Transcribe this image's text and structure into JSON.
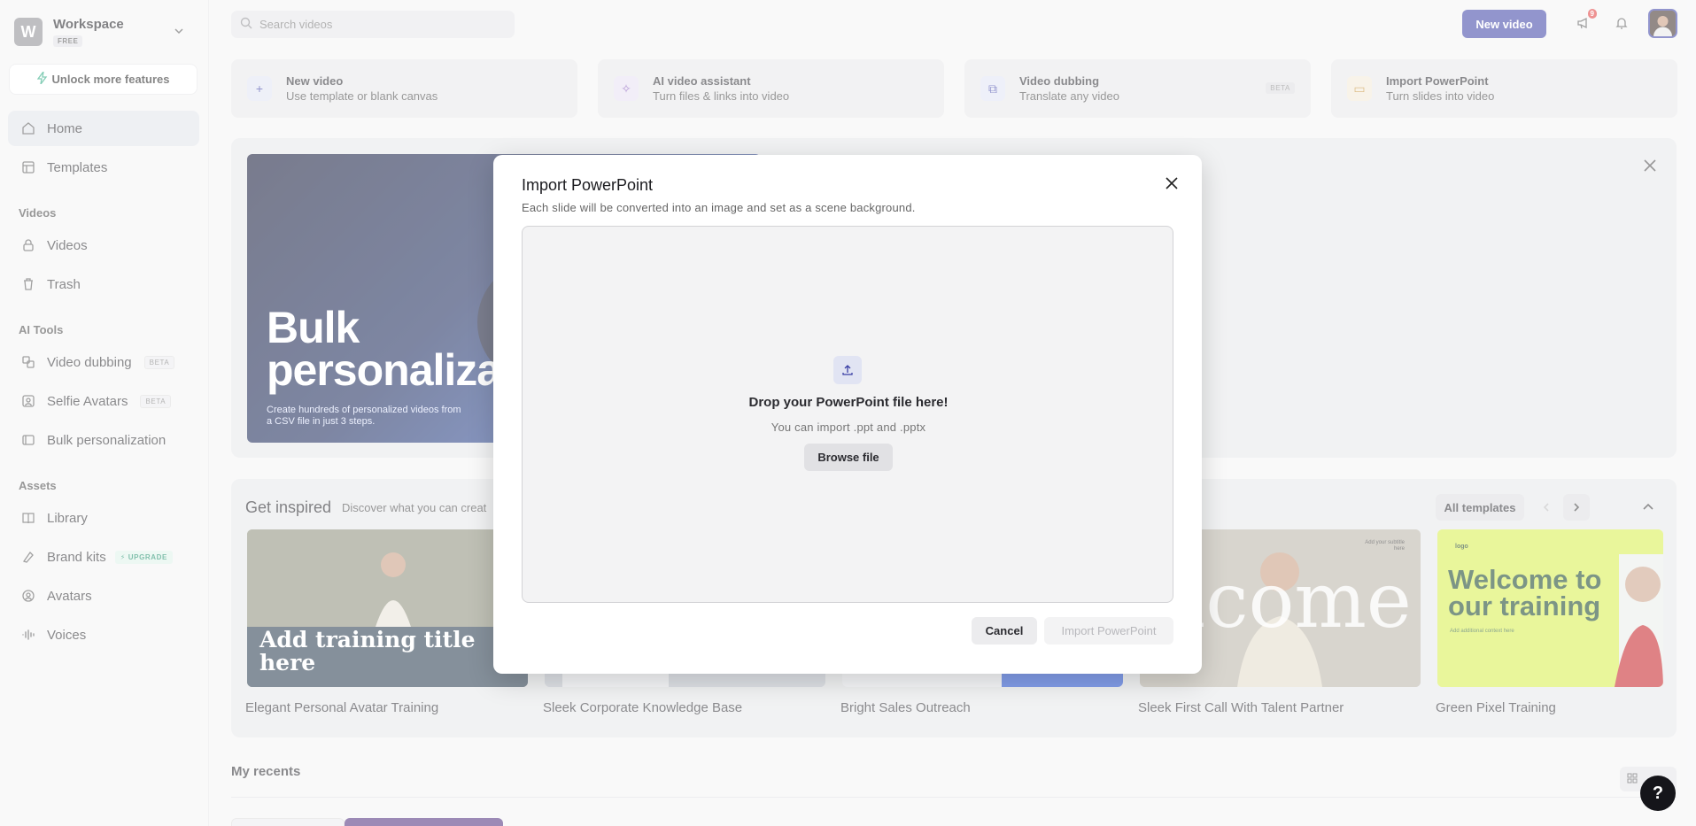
{
  "workspace": {
    "initial": "W",
    "name": "Workspace",
    "plan": "FREE"
  },
  "sidebar": {
    "unlock_label": "Unlock more features",
    "items_top": [
      {
        "label": "Home",
        "icon": "home-icon"
      },
      {
        "label": "Templates",
        "icon": "templates-icon"
      }
    ],
    "videos_section": "Videos",
    "videos_items": [
      {
        "label": "Videos",
        "icon": "lock-icon"
      },
      {
        "label": "Trash",
        "icon": "trash-icon"
      }
    ],
    "ai_section": "AI Tools",
    "ai_items": [
      {
        "label": "Video dubbing",
        "badge": "BETA",
        "icon": "dubbing-icon"
      },
      {
        "label": "Selfie Avatars",
        "badge": "BETA",
        "icon": "selfie-icon"
      },
      {
        "label": "Bulk personalization",
        "icon": "bulk-icon"
      }
    ],
    "assets_section": "Assets",
    "assets_items": [
      {
        "label": "Library",
        "icon": "book-icon"
      },
      {
        "label": "Brand kits",
        "badge": "UPGRADE",
        "icon": "brand-icon"
      },
      {
        "label": "Avatars",
        "icon": "avatar-icon"
      },
      {
        "label": "Voices",
        "icon": "waveform-icon"
      }
    ]
  },
  "topbar": {
    "search_placeholder": "Search videos",
    "new_video_label": "New video",
    "notification_count": "9"
  },
  "quick_cards": [
    {
      "title": "New video",
      "subtitle": "Use template or blank canvas",
      "icon": "plus-icon",
      "color": "#e1e3f2"
    },
    {
      "title": "AI video assistant",
      "subtitle": "Turn files & links into video",
      "icon": "sparkle-icon",
      "color": "#e8e0f2"
    },
    {
      "title": "Video dubbing",
      "subtitle": "Translate any video",
      "badge": "BETA",
      "icon": "dubbing-icon",
      "color": "#e0e4f5"
    },
    {
      "title": "Import PowerPoint",
      "subtitle": "Turn slides into video",
      "icon": "slides-icon",
      "color": "#f3ead8"
    }
  ],
  "banner": {
    "heading_line1": "Bulk",
    "heading_line2": "personalizati",
    "subtext": "Create hundreds of personalized videos from a CSV file in just 3 steps."
  },
  "inspired": {
    "title": "Get inspired",
    "subtitle": "Discover what you can creat",
    "all_templates_label": "All templates",
    "templates": [
      {
        "label": "Elegant Personal Avatar Training",
        "overlay_text": "Add training title here"
      },
      {
        "label": "Sleek Corporate Knowledge Base"
      },
      {
        "label": "Bright Sales Outreach"
      },
      {
        "label": "Sleek First Call With Talent Partner",
        "overlay_text": "elcome",
        "corner_text": "Add your subtitle here"
      },
      {
        "label": "Green Pixel Training",
        "overlay_text": "Welcome to our training",
        "logo_text": "logo",
        "small_text": "Add additional context here"
      }
    ]
  },
  "recents": {
    "title": "My recents"
  },
  "modal": {
    "title": "Import PowerPoint",
    "subtitle": "Each slide will be converted into an image and set as a scene background.",
    "drop_title": "Drop your PowerPoint file here!",
    "drop_subtitle": "You can import .ppt and .pptx",
    "browse_label": "Browse file",
    "cancel_label": "Cancel",
    "import_label": "Import PowerPoint"
  },
  "colors": {
    "accent": "#3a3fa5",
    "upgrade": "#1a8c68",
    "badge_red": "#e03a3a"
  }
}
